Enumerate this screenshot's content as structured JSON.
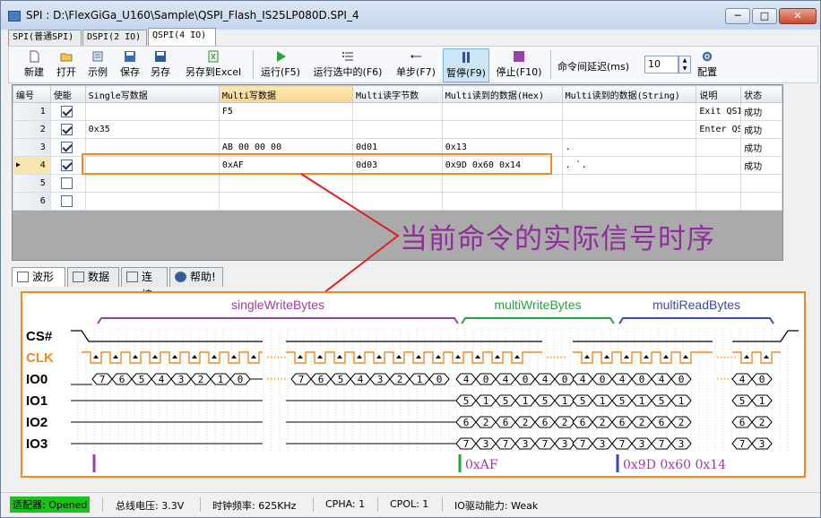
{
  "window": {
    "title": "SPI : D:\\FlexGiGa_U160\\Sample\\QSPI_Flash_IS25LP080D.SPI_4",
    "min": "─",
    "max": "□",
    "close": "✕"
  },
  "mode_tabs": [
    "SPI(普通SPI)",
    "DSPI(2 IO)",
    "QSPI(4 IO)"
  ],
  "toolbar": {
    "new": "新建",
    "open": "打开",
    "example": "示例",
    "save": "保存",
    "save_as": "另存",
    "save_excel": "另存到Excel",
    "run": "运行(F5)",
    "run_selected": "运行选中的(F6)",
    "step": "单步(F7)",
    "pause": "暂停(F9)",
    "stop": "停止(F10)",
    "delay_label": "命令间延迟(ms)",
    "delay_value": "10",
    "config": "配置"
  },
  "table": {
    "columns": [
      "编号",
      "使能",
      "Single写数据",
      "Multi写数据",
      "Multi读字节数",
      "Multi读到的数据(Hex)",
      "Multi读到的数据(String)",
      "说明",
      "状态"
    ],
    "rows": [
      {
        "n": "1",
        "en": true,
        "sw": "",
        "mw": "F5",
        "mr": "",
        "hex": "",
        "str": "",
        "desc": "Exit QSI",
        "st": "成功"
      },
      {
        "n": "2",
        "en": true,
        "sw": "0x35",
        "mw": "",
        "mr": "",
        "hex": "",
        "str": "",
        "desc": "Enter QS",
        "st": "成功"
      },
      {
        "n": "3",
        "en": true,
        "sw": "",
        "mw": "AB 00 00 00",
        "mr": "0d01",
        "hex": "0x13",
        "str": ".",
        "desc": "",
        "st": "成功"
      },
      {
        "n": "4",
        "en": true,
        "sw": "",
        "mw": "0xAF",
        "mr": "0d03",
        "hex": "0x9D 0x60 0x14",
        "str": ". `.",
        "desc": "",
        "st": "成功"
      },
      {
        "n": "5",
        "en": false,
        "sw": "",
        "mw": "",
        "mr": "",
        "hex": "",
        "str": "",
        "desc": "",
        "st": ""
      },
      {
        "n": "6",
        "en": false,
        "sw": "",
        "mw": "",
        "mr": "",
        "hex": "",
        "str": "",
        "desc": "",
        "st": ""
      }
    ]
  },
  "annotation": "当前命令的实际信号时序",
  "bottom_tabs": [
    "波形",
    "数据",
    "连接",
    "帮助!"
  ],
  "waveform": {
    "signals": [
      "CS#",
      "CLK",
      "IO0",
      "IO1",
      "IO2",
      "IO3"
    ],
    "groups": [
      "singleWriteBytes",
      "multiWriteBytes",
      "multiReadBytes"
    ],
    "markers": [
      "0xAF",
      "0x9D 0x60 0x14"
    ],
    "colors": {
      "single": "#9b3ea0",
      "multi_write": "#1fa83a",
      "multi_read": "#3a4aa8",
      "clk": "#f08a24",
      "annotation": "#8e2f9b"
    },
    "io0_single": [
      "7",
      "6",
      "5",
      "4",
      "3",
      "2",
      "1",
      "0"
    ],
    "io0_single2": [
      "7",
      "6",
      "5",
      "4",
      "3",
      "2",
      "1",
      "0"
    ],
    "io0_mw": [
      "4",
      "0",
      "4",
      "0",
      "4",
      "0"
    ],
    "io1_mw": [
      "5",
      "1",
      "5",
      "1",
      "5",
      "1"
    ],
    "io2_mw": [
      "6",
      "2",
      "6",
      "2",
      "6",
      "2"
    ],
    "io3_mw": [
      "7",
      "3",
      "7",
      "3",
      "7",
      "3"
    ],
    "io0_mr": [
      "4",
      "0",
      "4",
      "0",
      "4",
      "0",
      "4",
      "0"
    ],
    "io1_mr": [
      "5",
      "1",
      "5",
      "1",
      "5",
      "1",
      "5",
      "1"
    ],
    "io2_mr": [
      "6",
      "2",
      "6",
      "2",
      "6",
      "2",
      "6",
      "2"
    ],
    "io3_mr": [
      "7",
      "3",
      "7",
      "3",
      "7",
      "3",
      "7",
      "3"
    ]
  },
  "status": {
    "adapter": "适配器: Opened",
    "voltage": "总线电压: 3.3V",
    "clock": "时钟频率: 625KHz",
    "cpha": "CPHA: 1",
    "cpol": "CPOL: 1",
    "drive": "IO驱动能力: Weak"
  }
}
